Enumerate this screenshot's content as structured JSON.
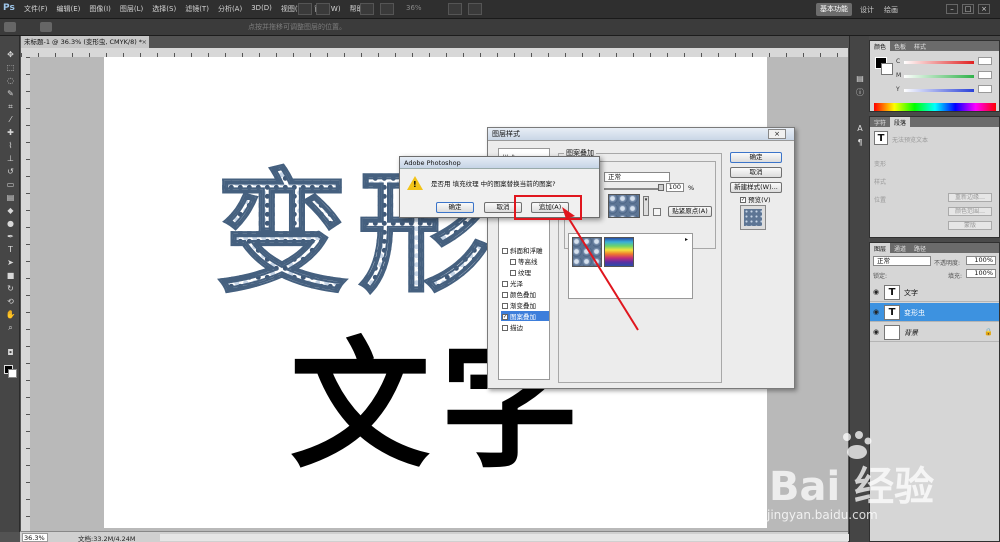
{
  "app": {
    "logo": "Ps"
  },
  "menubar": {
    "items": [
      "文件(F)",
      "编辑(E)",
      "图像(I)",
      "图层(L)",
      "选择(S)",
      "滤镜(T)",
      "分析(A)",
      "3D(D)",
      "视图(V)",
      "窗口(W)",
      "帮助(H)"
    ],
    "zoom": "36%",
    "workspace_button": "基本功能",
    "workspace_links": [
      "设计",
      "绘画"
    ],
    "window_controls": [
      "–",
      "□",
      "×"
    ]
  },
  "optbar": {
    "hint": "点按并拖移可调整图层的位置。"
  },
  "document": {
    "tab_title": "未标题-1 @ 36.3% (变形虫, CMYK/8) *",
    "tab_close": "×",
    "patterned_text": "变形",
    "black_text": "文字"
  },
  "statusbar": {
    "zoom": "36.3%",
    "doc_info": "文档:33.2M/4.24M"
  },
  "color_panel": {
    "tabs": [
      "颜色",
      "色板",
      "样式"
    ],
    "rows": [
      {
        "label": "C",
        "color": "#e02020"
      },
      {
        "label": "M",
        "color": "#2fb24a"
      },
      {
        "label": "Y",
        "color": "#2840d8"
      }
    ]
  },
  "char_panel": {
    "tabs": [
      "字符",
      "段落"
    ],
    "placeholder": "无法预览文本",
    "labels": [
      "变形",
      "样式",
      "位置"
    ],
    "buttons": [
      "重新边缘…",
      "颜色范围…",
      "蒙版"
    ]
  },
  "layers_panel": {
    "tabs": [
      "图层",
      "通道",
      "路径"
    ],
    "blend_mode": "正常",
    "opacity_label": "不透明度:",
    "opacity": "100%",
    "lock_label": "锁定:",
    "fill_label": "填充:",
    "fill": "100%",
    "layers": [
      {
        "name": "文字",
        "thumb": "T",
        "selected": false
      },
      {
        "name": "变形虫",
        "thumb": "T",
        "selected": true
      },
      {
        "name": "背景",
        "thumb": "",
        "selected": false
      }
    ]
  },
  "style_dialog": {
    "title": "图层样式",
    "close": "×",
    "list": [
      {
        "label": "样式",
        "checkbox": false,
        "sub": false,
        "checked": false
      },
      {
        "label": "斜面和浮雕",
        "checkbox": true,
        "sub": false,
        "checked": false
      },
      {
        "label": "等高线",
        "checkbox": true,
        "sub": true,
        "checked": false
      },
      {
        "label": "纹理",
        "checkbox": true,
        "sub": true,
        "checked": false
      },
      {
        "label": "光泽",
        "checkbox": true,
        "sub": false,
        "checked": false
      },
      {
        "label": "颜色叠加",
        "checkbox": true,
        "sub": false,
        "checked": false
      },
      {
        "label": "渐变叠加",
        "checkbox": true,
        "sub": false,
        "checked": false
      },
      {
        "label": "图案叠加",
        "checkbox": true,
        "sub": false,
        "checked": true
      },
      {
        "label": "描边",
        "checkbox": true,
        "sub": false,
        "checked": false
      }
    ],
    "group_title": "图案叠加",
    "blend_mode": "正常",
    "opacity": "100",
    "percent": "%",
    "snap_button": "贴紧原点(A)",
    "buttons": {
      "ok": "确定",
      "cancel": "取消",
      "new_style": "新建样式(W)...",
      "preview": "预览(V)"
    }
  },
  "alert": {
    "title": "Adobe Photoshop",
    "message": "是否用 填充纹理 中的图案替换当前的图案?",
    "ok": "确定",
    "cancel": "取消",
    "append": "追加(A)"
  },
  "watermark": {
    "main": "Bai 经验",
    "sub": "jingyan.baidu.com"
  }
}
